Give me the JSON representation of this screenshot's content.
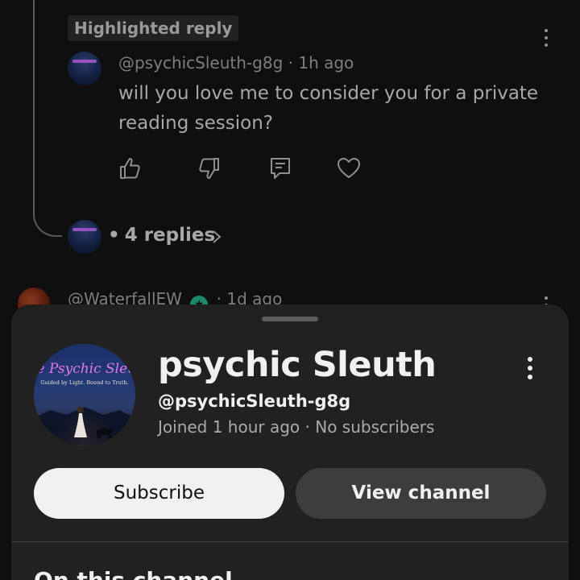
{
  "thread": {
    "highlight_badge": "Highlighted reply",
    "reply": {
      "author": "@psychicSleuth-g8g",
      "time": "1h ago",
      "text": "will you love me to consider you for a private reading session?"
    },
    "replies_count": "4 replies",
    "next_comment": {
      "author": "@WaterfallEW",
      "time": "1d ago"
    }
  },
  "sheet": {
    "avatar_text": {
      "title": "The Psychic Sleuth",
      "tagline": "Guided by Light. Bound to Truth."
    },
    "channel_name": "psychic Sleuth",
    "handle": "@psychicSleuth-g8g",
    "joined": "Joined 1 hour ago",
    "subscribers": "No subscribers",
    "subscribe_label": "Subscribe",
    "view_channel_label": "View channel",
    "section_title": "On this channel"
  },
  "colors": {
    "background": "#0f0f0f",
    "sheet": "#212121",
    "subscribe_bg": "#f1f1f1",
    "view_channel_bg": "#3d3d3d",
    "verified": "#1b8a6b"
  }
}
